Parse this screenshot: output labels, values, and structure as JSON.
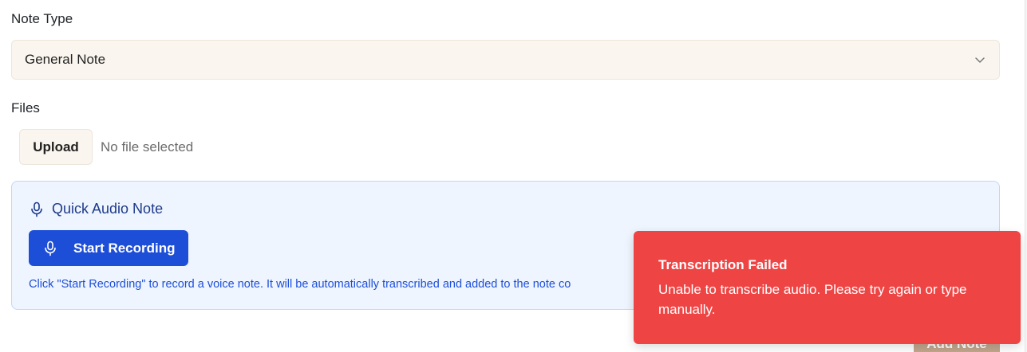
{
  "note_type": {
    "label": "Note Type",
    "selected": "General Note"
  },
  "files": {
    "label": "Files",
    "upload_label": "Upload",
    "status": "No file selected"
  },
  "audio": {
    "title": "Quick Audio Note",
    "record_label": "Start Recording",
    "hint": "Click \"Start Recording\" to record a voice note. It will be automatically transcribed and added to the note co"
  },
  "footer": {
    "add_note_label": "Add Note"
  },
  "toast": {
    "title": "Transcription Failed",
    "message": "Unable to transcribe audio. Please try again or type manually."
  },
  "colors": {
    "primary": "#1d4ed8",
    "error": "#ef4444",
    "select_bg": "#faf5ee",
    "audio_panel_bg": "#eef5ff"
  },
  "icons": {
    "select_chevron": "chevron-down-icon",
    "audio_title": "microphone-icon",
    "record_button": "microphone-icon"
  }
}
